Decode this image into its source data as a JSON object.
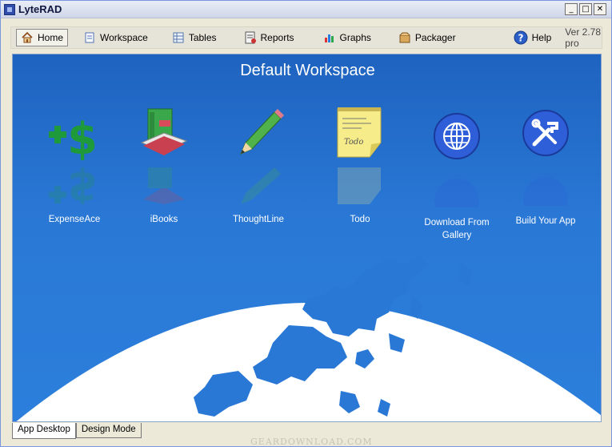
{
  "window": {
    "title": "LyteRAD"
  },
  "toolbar": {
    "items": [
      {
        "label": "Home",
        "icon": "home-icon"
      },
      {
        "label": "Workspace",
        "icon": "document-icon"
      },
      {
        "label": "Tables",
        "icon": "table-icon"
      },
      {
        "label": "Reports",
        "icon": "report-icon"
      },
      {
        "label": "Graphs",
        "icon": "bar-chart-icon"
      },
      {
        "label": "Packager",
        "icon": "package-icon"
      }
    ],
    "help_label": "Help",
    "version": "Ver 2.78 pro"
  },
  "workspace": {
    "title": "Default Workspace",
    "apps": [
      {
        "label": "ExpenseAce",
        "icon": "dollar-plus-icon"
      },
      {
        "label": "iBooks",
        "icon": "books-icon"
      },
      {
        "label": "ThoughtLine",
        "icon": "pencil-icon"
      },
      {
        "label": "Todo",
        "icon": "notepad-icon"
      },
      {
        "label": "Download From Gallery",
        "icon": "globe-icon"
      },
      {
        "label": "Build Your App",
        "icon": "tools-icon"
      }
    ]
  },
  "tabs": [
    {
      "label": "App Desktop",
      "active": true
    },
    {
      "label": "Design Mode",
      "active": false
    }
  ],
  "watermark": "GEARDOWNLOAD.COM",
  "colors": {
    "desktop_blue": "#2a78d6",
    "accent_green": "#1f9a3a"
  }
}
